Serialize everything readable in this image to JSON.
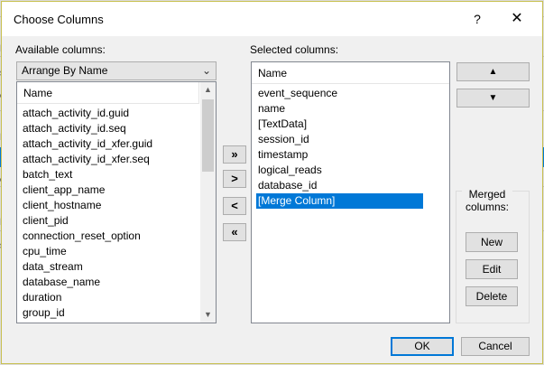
{
  "background": {
    "left_fragments": [
      "L",
      "sk",
      "e",
      "L",
      "ee",
      "L",
      "sk"
    ]
  },
  "dialog": {
    "title": "Choose Columns",
    "help_label": "?",
    "close_label": "✕",
    "available_label": "Available columns:",
    "arrange_value": "Arrange By Name",
    "available_header": "Name",
    "available_items": [
      "attach_activity_id.guid",
      "attach_activity_id.seq",
      "attach_activity_id_xfer.guid",
      "attach_activity_id_xfer.seq",
      "batch_text",
      "client_app_name",
      "client_hostname",
      "client_pid",
      "connection_reset_option",
      "cpu_time",
      "data_stream",
      "database_name",
      "duration",
      "group_id"
    ],
    "selected_label": "Selected columns:",
    "selected_header": "Name",
    "selected_items": [
      "event_sequence",
      "name",
      "[TextData]",
      "session_id",
      "timestamp",
      "logical_reads",
      "database_id",
      "[Merge Column]"
    ],
    "selected_index": 7,
    "move_buttons": {
      "add_all": "»",
      "add": ">",
      "remove": "<",
      "remove_all": "«"
    },
    "order_buttons": {
      "up": "▲",
      "down": "▼"
    },
    "merged": {
      "label": "Merged columns:",
      "new_label": "New",
      "edit_label": "Edit",
      "delete_label": "Delete"
    },
    "ok_label": "OK",
    "cancel_label": "Cancel"
  }
}
